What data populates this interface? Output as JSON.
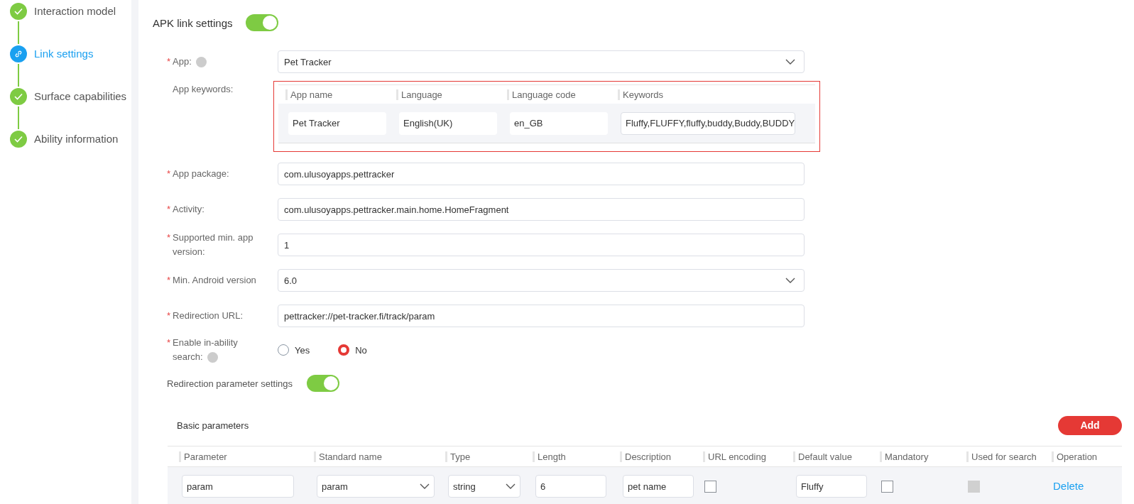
{
  "steps": [
    {
      "label": "Interaction model",
      "selected": false
    },
    {
      "label": "Link settings",
      "selected": true
    },
    {
      "label": "Surface capabilities",
      "selected": false
    },
    {
      "label": "Ability information",
      "selected": false
    }
  ],
  "apk_link": {
    "label": "APK link settings",
    "on": true
  },
  "app_field": {
    "label": "App:",
    "required_mark": "*",
    "help": true,
    "value": "Pet Tracker"
  },
  "app_keywords": {
    "label": "App keywords:",
    "columns": [
      "App name",
      "Language",
      "Language code",
      "Keywords"
    ],
    "rows": [
      [
        "Pet Tracker",
        "English(UK)",
        "en_GB",
        "Fluffy,FLUFFY,fluffy,buddy,Buddy,BUDDY"
      ]
    ]
  },
  "fields": [
    {
      "kind": "input",
      "label": "App package:",
      "required_mark": "*",
      "help": false,
      "value": "com.ulusoyapps.pettracker"
    },
    {
      "kind": "input",
      "label": "Activity:",
      "required_mark": "*",
      "help": false,
      "value": "com.ulusoyapps.pettracker.main.home.HomeFragment"
    },
    {
      "kind": "input",
      "label": "Supported min. app version:",
      "required_mark": "*",
      "help": false,
      "value": "1"
    },
    {
      "kind": "select",
      "label": "Min. Android version",
      "required_mark": "*",
      "help": false,
      "value": "6.0"
    },
    {
      "kind": "input",
      "label": "Redirection URL:",
      "required_mark": "*",
      "help": false,
      "value": "pettracker://pet-tracker.fi/track/param"
    },
    {
      "kind": "radio",
      "label": "Enable in-ability search:",
      "required_mark": "*",
      "help": true,
      "options": [
        {
          "label": "Yes",
          "selected": false
        },
        {
          "label": "No",
          "selected": true
        }
      ]
    }
  ],
  "redirection_params": {
    "label": "Redirection parameter settings",
    "on": true
  },
  "basic_parameters": {
    "title": "Basic parameters",
    "add_button": "Add",
    "columns": [
      "Parameter",
      "Standard name",
      "Type",
      "Length",
      "Description",
      "URL encoding",
      "Default value",
      "Mandatory",
      "Used for search",
      "Operation"
    ],
    "rows": [
      [
        {
          "kind": "input",
          "value": "param"
        },
        {
          "kind": "select",
          "value": "param"
        },
        {
          "kind": "select",
          "value": "string"
        },
        {
          "kind": "input",
          "value": "6"
        },
        {
          "kind": "input",
          "value": "pet name"
        },
        {
          "kind": "checkbox",
          "checked": false,
          "disabled": false
        },
        {
          "kind": "input",
          "value": "Fluffy"
        },
        {
          "kind": "checkbox",
          "checked": false,
          "disabled": false
        },
        {
          "kind": "checkbox",
          "checked": false,
          "disabled": true
        },
        {
          "kind": "link",
          "value": "Delete"
        }
      ]
    ]
  }
}
